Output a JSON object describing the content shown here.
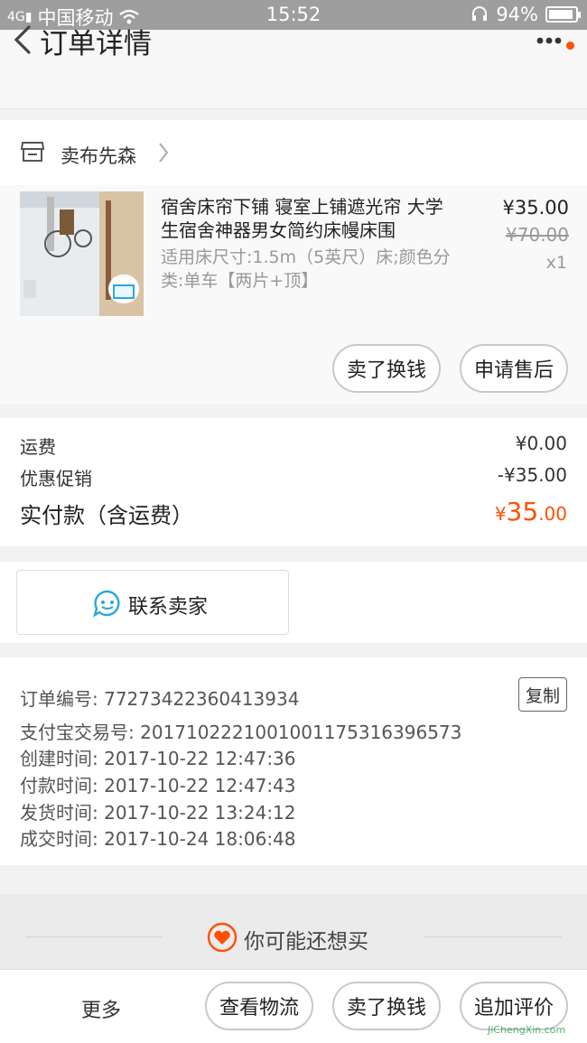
{
  "status_bar": {
    "carrier": "中国移动",
    "time": "15:52",
    "battery": "94%",
    "battery_level": 0.94
  },
  "header": {
    "title": "订单详情"
  },
  "shop": {
    "name": "卖布先森"
  },
  "product": {
    "title": "宿舍床帘下铺 寝室上铺遮光帘 大学生宿舍神器男女简约床幔床围",
    "sku": "适用床尺寸:1.5m（5英尺）床;颜色分类:单车【两片+顶】",
    "price": "¥35.00",
    "original_price": "¥70.00",
    "quantity": "x1",
    "actions": [
      "卖了换钱",
      "申请售后"
    ]
  },
  "fees": {
    "shipping_label": "运费",
    "shipping_value": "¥0.00",
    "discount_label": "优惠促销",
    "discount_value": "-¥35.00",
    "total_label": "实付款（含运费）",
    "total_symbol": "¥",
    "total_int": "35",
    "total_dec": ".00"
  },
  "contact": {
    "label": "联系卖家"
  },
  "order_info": {
    "order_no": "订单编号: 77273422360413934",
    "copy_label": "复制",
    "alipay_no": "支付宝交易号: 2017102221001001175316396573",
    "created": "创建时间: 2017-10-22 12:47:36",
    "paid": "付款时间: 2017-10-22 12:47:43",
    "shipped": "发货时间: 2017-10-22 13:24:12",
    "completed": "成交时间: 2017-10-24 18:06:48"
  },
  "recommend": {
    "label": "你可能还想买"
  },
  "bottom_bar": {
    "more": "更多",
    "logistics": "查看物流",
    "resell": "卖了换钱",
    "review": "追加评价"
  },
  "watermark": {
    "text": "JiChengXin.com"
  },
  "colors": {
    "accent": "#ff5000",
    "contact_icon": "#29a8e0"
  }
}
